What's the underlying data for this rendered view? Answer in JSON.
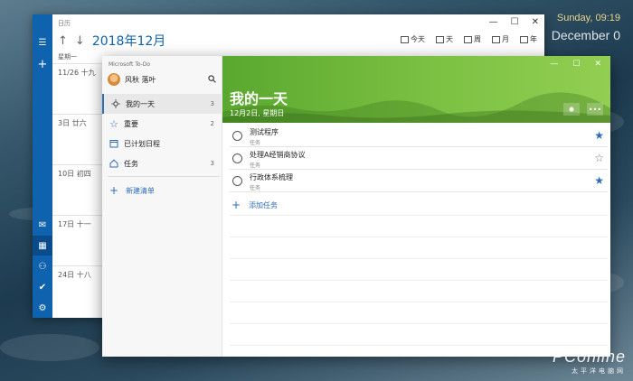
{
  "desktop": {
    "clock_day": "Sunday, 09:19",
    "clock_month": "December 0"
  },
  "calendar": {
    "window_title": "日历",
    "month_title": "2018年12月",
    "toolbar": [
      "今天",
      "天",
      "周",
      "月",
      "年"
    ],
    "week_header": "星期一",
    "rows": [
      "11/26 十九",
      "3日 廿六",
      "10日 初四",
      "17日 十一",
      "24日 十八"
    ]
  },
  "todo": {
    "app_title": "Microsoft To-Do",
    "user_name": "风秋 落叶",
    "lists": [
      {
        "label": "我的一天",
        "count": "3"
      },
      {
        "label": "重要",
        "count": "2"
      },
      {
        "label": "已计划日程",
        "count": ""
      },
      {
        "label": "任务",
        "count": "3"
      }
    ],
    "new_list_label": "新建清单",
    "header_title": "我的一天",
    "header_date": "12月2日, 星期日",
    "tasks": [
      {
        "title": "测试程序",
        "subtitle": "任务",
        "starred": true
      },
      {
        "title": "处理A经销商协议",
        "subtitle": "任务",
        "starred": false
      },
      {
        "title": "行政体系梳理",
        "subtitle": "任务",
        "starred": true
      }
    ],
    "add_task_label": "添加任务"
  },
  "watermark": {
    "brand": "PConline",
    "tagline": "太平洋电脑网"
  }
}
